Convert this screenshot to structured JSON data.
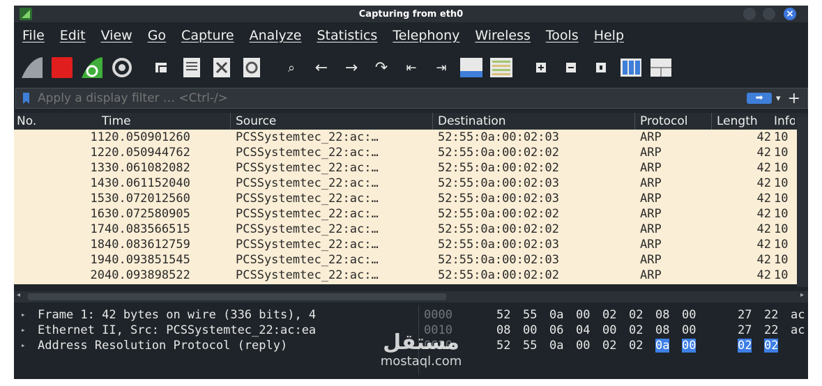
{
  "window": {
    "title": "Capturing from eth0"
  },
  "menu": [
    "File",
    "Edit",
    "View",
    "Go",
    "Capture",
    "Analyze",
    "Statistics",
    "Telephony",
    "Wireless",
    "Tools",
    "Help"
  ],
  "toolbar": [
    {
      "name": "shark-fin-start-icon",
      "glyph": "◢"
    },
    {
      "name": "stop-capture-icon",
      "glyph": "■"
    },
    {
      "name": "restart-capture-icon",
      "glyph": "↻"
    },
    {
      "name": "capture-options-gear-icon",
      "glyph": "⚙"
    },
    {
      "name": "open-file-icon",
      "glyph": "▣"
    },
    {
      "name": "save-file-icon",
      "glyph": "▦"
    },
    {
      "name": "close-file-icon",
      "glyph": "⊠"
    },
    {
      "name": "reload-file-icon",
      "glyph": "↺"
    },
    {
      "name": "find-packet-icon",
      "glyph": "🔍"
    },
    {
      "name": "go-back-icon",
      "glyph": "←"
    },
    {
      "name": "go-forward-icon",
      "glyph": "→"
    },
    {
      "name": "go-to-packet-icon",
      "glyph": "↷"
    },
    {
      "name": "first-packet-icon",
      "glyph": "⇤"
    },
    {
      "name": "last-packet-icon",
      "glyph": "⇥"
    },
    {
      "name": "autoscroll-icon",
      "glyph": "▬"
    },
    {
      "name": "colorize-icon",
      "glyph": "☰"
    },
    {
      "name": "zoom-in-icon",
      "glyph": "⊞"
    },
    {
      "name": "zoom-out-icon",
      "glyph": "⊟"
    },
    {
      "name": "normal-size-icon",
      "glyph": "⊡"
    },
    {
      "name": "resize-columns-icon",
      "glyph": "▥"
    },
    {
      "name": "layout-icon",
      "glyph": "▤"
    }
  ],
  "filter": {
    "placeholder": "Apply a display filter … <Ctrl-/>"
  },
  "columns": {
    "no": "No.",
    "time": "Time",
    "source": "Source",
    "destination": "Destination",
    "protocol": "Protocol",
    "length": "Length",
    "info": "Info"
  },
  "packets": [
    {
      "no": "11",
      "time": "20.050901260",
      "source": "PCSSystemtec_22:ac:…",
      "destination": "52:55:0a:00:02:03",
      "protocol": "ARP",
      "length": "42",
      "info": "10"
    },
    {
      "no": "12",
      "time": "20.050944762",
      "source": "PCSSystemtec_22:ac:…",
      "destination": "52:55:0a:00:02:02",
      "protocol": "ARP",
      "length": "42",
      "info": "10"
    },
    {
      "no": "13",
      "time": "30.061082082",
      "source": "PCSSystemtec_22:ac:…",
      "destination": "52:55:0a:00:02:02",
      "protocol": "ARP",
      "length": "42",
      "info": "10"
    },
    {
      "no": "14",
      "time": "30.061152040",
      "source": "PCSSystemtec_22:ac:…",
      "destination": "52:55:0a:00:02:03",
      "protocol": "ARP",
      "length": "42",
      "info": "10"
    },
    {
      "no": "15",
      "time": "30.072012560",
      "source": "PCSSystemtec_22:ac:…",
      "destination": "52:55:0a:00:02:03",
      "protocol": "ARP",
      "length": "42",
      "info": "10"
    },
    {
      "no": "16",
      "time": "30.072580905",
      "source": "PCSSystemtec_22:ac:…",
      "destination": "52:55:0a:00:02:02",
      "protocol": "ARP",
      "length": "42",
      "info": "10"
    },
    {
      "no": "17",
      "time": "40.083566515",
      "source": "PCSSystemtec_22:ac:…",
      "destination": "52:55:0a:00:02:02",
      "protocol": "ARP",
      "length": "42",
      "info": "10"
    },
    {
      "no": "18",
      "time": "40.083612759",
      "source": "PCSSystemtec_22:ac:…",
      "destination": "52:55:0a:00:02:03",
      "protocol": "ARP",
      "length": "42",
      "info": "10"
    },
    {
      "no": "19",
      "time": "40.093851545",
      "source": "PCSSystemtec_22:ac:…",
      "destination": "52:55:0a:00:02:03",
      "protocol": "ARP",
      "length": "42",
      "info": "10"
    },
    {
      "no": "20",
      "time": "40.093898522",
      "source": "PCSSystemtec_22:ac:…",
      "destination": "52:55:0a:00:02:02",
      "protocol": "ARP",
      "length": "42",
      "info": "10"
    }
  ],
  "details": [
    "Frame 1: 42 bytes on wire (336 bits), 4",
    "Ethernet II, Src: PCSSystemtec_22:ac:ea",
    "Address Resolution Protocol (reply)"
  ],
  "hex": [
    {
      "offset": "0000",
      "bytes": [
        "52",
        "55",
        "0a",
        "00",
        "02",
        "02",
        "08",
        "00",
        "27",
        "22",
        "ac"
      ]
    },
    {
      "offset": "0010",
      "bytes": [
        "08",
        "00",
        "06",
        "04",
        "00",
        "02",
        "08",
        "00",
        "27",
        "22",
        "ac"
      ]
    },
    {
      "offset": "0020",
      "bytes": [
        "52",
        "55",
        "0a",
        "00",
        "02",
        "02",
        "0a",
        "00",
        "02",
        "02"
      ]
    }
  ],
  "watermark": {
    "logo": "مستقل",
    "url": "mostaql.com"
  },
  "colors": {
    "packet_row_bg": "#fbeed6",
    "selection": "#3d7fe6",
    "window_bg": "#1e2429"
  }
}
